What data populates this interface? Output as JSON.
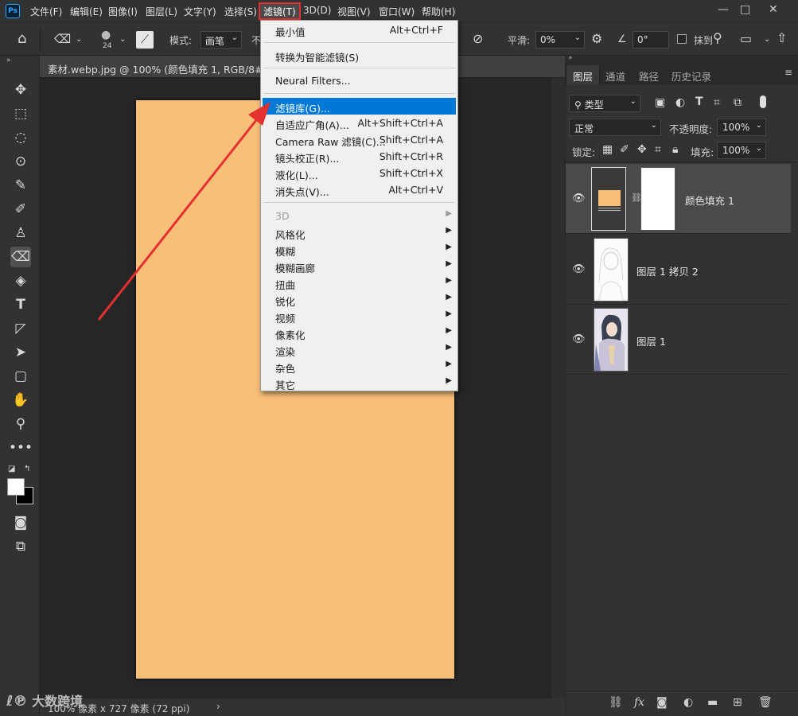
{
  "app": {
    "logo": "Ps"
  },
  "menubar": {
    "items": [
      "文件(F)",
      "编辑(E)",
      "图像(I)",
      "图层(L)",
      "文字(Y)",
      "选择(S)",
      "滤镜(T)",
      "3D(D)",
      "视图(V)",
      "窗口(W)",
      "帮助(H)"
    ],
    "window_controls": [
      "minimize-icon",
      "maximize-icon",
      "close-icon"
    ]
  },
  "options": {
    "brush_size": "24",
    "mode_label": "模式:",
    "mode_value": "画笔",
    "opacity_label_partial": "不",
    "smoothing_label": "平滑:",
    "smoothing_value": "0%",
    "angle_value": "0°",
    "erase_history_label": "抹到"
  },
  "document": {
    "tab_label": "素材.webp.jpg @ 100% (颜色填充 1, RGB/8#) *",
    "canvas_color": "#f8bf78",
    "status_text": "100%    像素 x 727 像素 (72 ppi)"
  },
  "watermark": "大数跨境",
  "filter_menu": {
    "items": [
      {
        "label": "最小值",
        "shortcut": "Alt+Ctrl+F"
      },
      {
        "label": "转换为智能滤镜(S)",
        "shortcut": ""
      },
      {
        "label": "Neural Filters...",
        "shortcut": ""
      },
      {
        "label": "滤镜库(G)...",
        "shortcut": ""
      },
      {
        "label": "自适应广角(A)...",
        "shortcut": "Alt+Shift+Ctrl+A"
      },
      {
        "label": "Camera Raw 滤镜(C)...",
        "shortcut": "Shift+Ctrl+A"
      },
      {
        "label": "镜头校正(R)...",
        "shortcut": "Shift+Ctrl+R"
      },
      {
        "label": "液化(L)...",
        "shortcut": "Shift+Ctrl+X"
      },
      {
        "label": "消失点(V)...",
        "shortcut": "Alt+Ctrl+V"
      },
      {
        "label": "3D",
        "shortcut": ""
      },
      {
        "label": "风格化",
        "shortcut": ""
      },
      {
        "label": "模糊",
        "shortcut": ""
      },
      {
        "label": "模糊画廊",
        "shortcut": ""
      },
      {
        "label": "扭曲",
        "shortcut": ""
      },
      {
        "label": "锐化",
        "shortcut": ""
      },
      {
        "label": "视频",
        "shortcut": ""
      },
      {
        "label": "像素化",
        "shortcut": ""
      },
      {
        "label": "渲染",
        "shortcut": ""
      },
      {
        "label": "杂色",
        "shortcut": ""
      },
      {
        "label": "其它",
        "shortcut": ""
      }
    ]
  },
  "layers_panel": {
    "tabs": [
      "图层",
      "通道",
      "路径",
      "历史记录"
    ],
    "filter_kind": "类型",
    "blend_mode": "正常",
    "opacity_label": "不透明度:",
    "opacity_value": "100%",
    "lock_label": "锁定:",
    "fill_label": "填充:",
    "fill_value": "100%",
    "layers": [
      {
        "name": "颜色填充 1",
        "selected": true
      },
      {
        "name": "图层 1 拷贝 2",
        "selected": false
      },
      {
        "name": "图层 1",
        "selected": false
      }
    ],
    "footer_icons": [
      "link-icon",
      "fx-icon",
      "mask-icon",
      "adjustment-icon",
      "group-folder-icon",
      "new-layer-icon",
      "trash-icon"
    ]
  },
  "colors": {
    "highlight": "#0078d7",
    "annotation_red": "#e53030",
    "fill_swatch": "#f8bf78"
  }
}
